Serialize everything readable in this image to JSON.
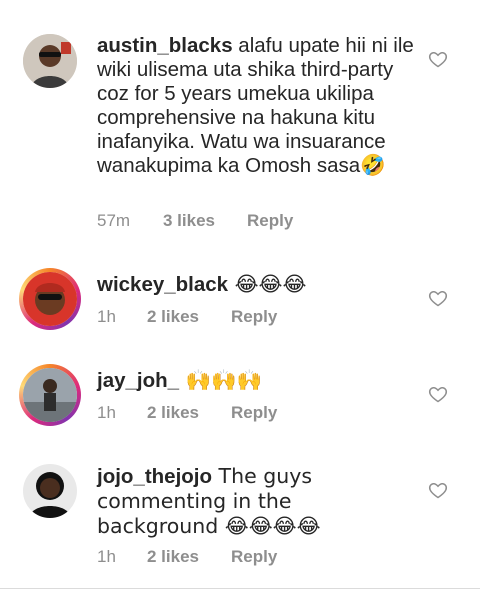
{
  "comments": [
    {
      "username": "austin_blacks",
      "text": " alafu upate hii ni ile wiki ulisema uta shika third-party coz for 5 years umekua ukilipa comprehensive na hakuna kitu inafanyika. Watu wa insuarance wanakupima ka Omosh sasa🤣",
      "time": "57m",
      "likes": "3 likes",
      "reply": "Reply"
    },
    {
      "username": "wickey_black",
      "text": " 😂😂😂",
      "time": "1h",
      "likes": "2 likes",
      "reply": "Reply"
    },
    {
      "username": "jay_joh_",
      "text": " 🙌🙌🙌",
      "time": "1h",
      "likes": "2 likes",
      "reply": "Reply"
    },
    {
      "username": "jojo_thejojo",
      "text": " The guys commenting in the background 😂😂😂😂",
      "time": "1h",
      "likes": "2 likes",
      "reply": "Reply"
    }
  ],
  "icons": {
    "like": "heart-outline-icon",
    "avatar": "user-avatar"
  },
  "colors": {
    "text": "#262626",
    "meta": "#8e8e8e",
    "story_ring_start": "#f58529",
    "story_ring_end": "#dd2a7b"
  }
}
